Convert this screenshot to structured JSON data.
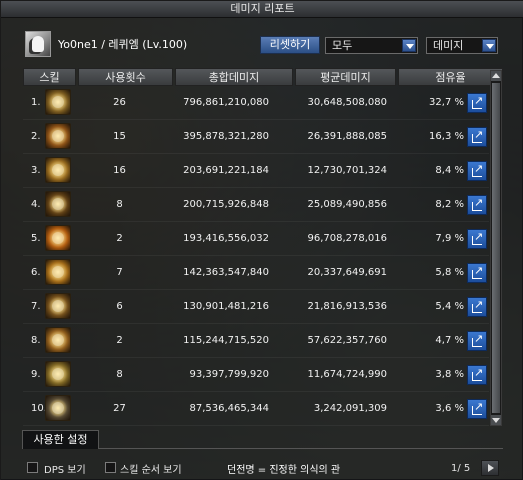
{
  "window": {
    "title": "데미지 리포트"
  },
  "header": {
    "character": "Yo0ne1  /  레퀴엠 (Lv.100)",
    "reset_label": "리셋하기",
    "filter_value": "모두",
    "metric_value": "데미지"
  },
  "table": {
    "columns": [
      "스킬",
      "사용횟수",
      "총합데미지",
      "평균데미지",
      "점유율"
    ],
    "rows": [
      {
        "rank": "1.",
        "uses": "26",
        "total": "796,861,210,080",
        "avg": "30,648,508,080",
        "share": "32,7 %",
        "icon_color": "#7a5a1e"
      },
      {
        "rank": "2.",
        "uses": "15",
        "total": "395,878,321,280",
        "avg": "26,391,888,085",
        "share": "16,3 %",
        "icon_color": "#8a4e14"
      },
      {
        "rank": "3.",
        "uses": "16",
        "total": "203,691,221,184",
        "avg": "12,730,701,324",
        "share": "8,4 %",
        "icon_color": "#94671c"
      },
      {
        "rank": "4.",
        "uses": "8",
        "total": "200,715,926,848",
        "avg": "25,089,490,856",
        "share": "8,2 %",
        "icon_color": "#5b3b12"
      },
      {
        "rank": "5.",
        "uses": "2",
        "total": "193,416,556,032",
        "avg": "96,708,278,016",
        "share": "7,9 %",
        "icon_color": "#b0580c"
      },
      {
        "rank": "6.",
        "uses": "7",
        "total": "142,363,547,840",
        "avg": "20,337,649,691",
        "share": "5,8 %",
        "icon_color": "#a36a16"
      },
      {
        "rank": "7.",
        "uses": "6",
        "total": "130,901,481,216",
        "avg": "21,816,913,536",
        "share": "5,4 %",
        "icon_color": "#6e4a18"
      },
      {
        "rank": "8.",
        "uses": "2",
        "total": "115,244,715,520",
        "avg": "57,622,357,760",
        "share": "4,7 %",
        "icon_color": "#8d5a1a"
      },
      {
        "rank": "9.",
        "uses": "8",
        "total": "93,397,799,920",
        "avg": "11,674,724,990",
        "share": "3,8 %",
        "icon_color": "#7c6422"
      },
      {
        "rank": "10.",
        "uses": "27",
        "total": "87,536,465,344",
        "avg": "3,242,091,309",
        "share": "3,6 %",
        "icon_color": "#4d4230"
      }
    ]
  },
  "footer": {
    "tab_label": "사용한 설정",
    "dps_label": "DPS 보기",
    "order_label": "스킬 순서 보기",
    "title_info": "던전명 = 진정한 의식의 관",
    "page": "1/ 5"
  }
}
